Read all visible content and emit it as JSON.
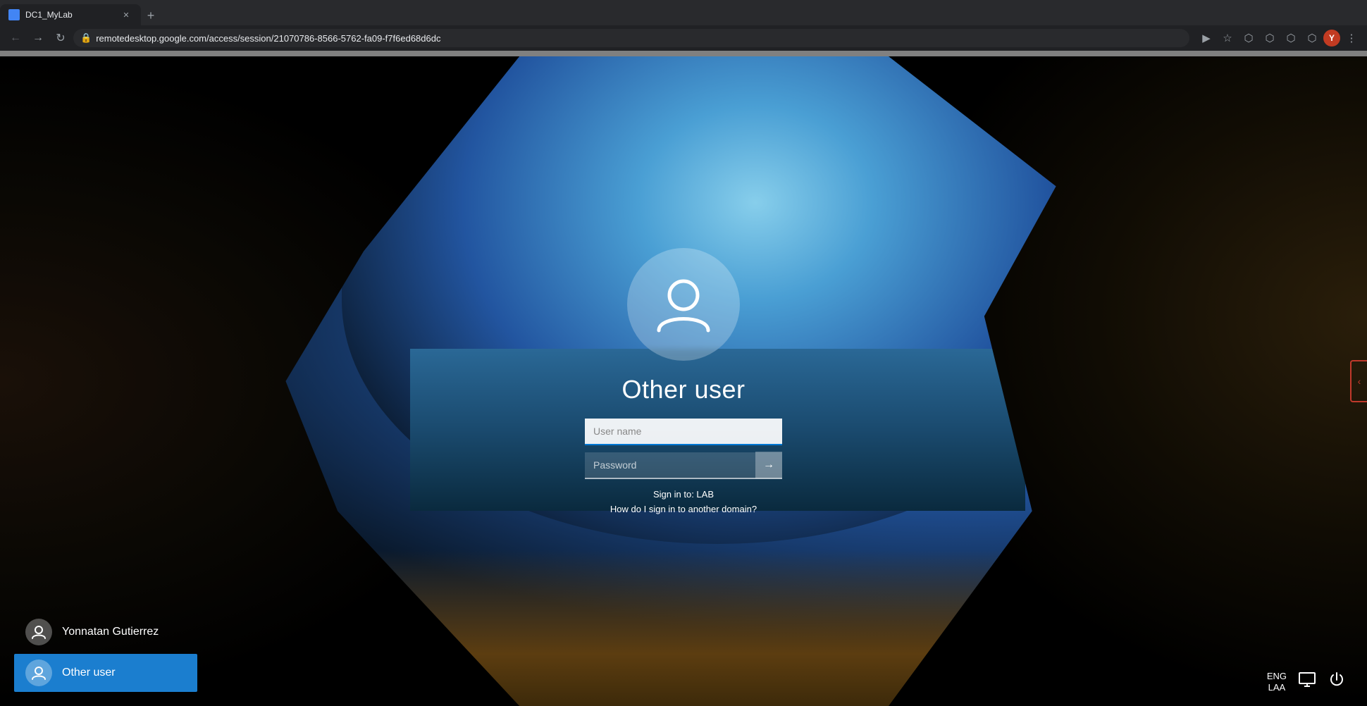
{
  "browser": {
    "tab": {
      "title": "DC1_MyLab",
      "favicon": "dc"
    },
    "url": "remotedesktop.google.com/access/session/21070786-8566-5762-fa09-f7f6ed68d6dc",
    "new_tab_label": "+"
  },
  "login": {
    "avatar_icon": "👤",
    "username_title": "Other user",
    "username_placeholder": "User name",
    "password_placeholder": "Password",
    "sign_in_label": "Sign in to: LAB",
    "domain_link": "How do I sign in to another domain?",
    "submit_arrow": "→"
  },
  "users": [
    {
      "name": "Yonnatan Gutierrez",
      "active": false
    },
    {
      "name": "Other user",
      "active": true
    }
  ],
  "system_tray": {
    "language_line1": "ENG",
    "language_line2": "LAA",
    "monitor_icon": "⊡",
    "power_icon": "⏻"
  }
}
